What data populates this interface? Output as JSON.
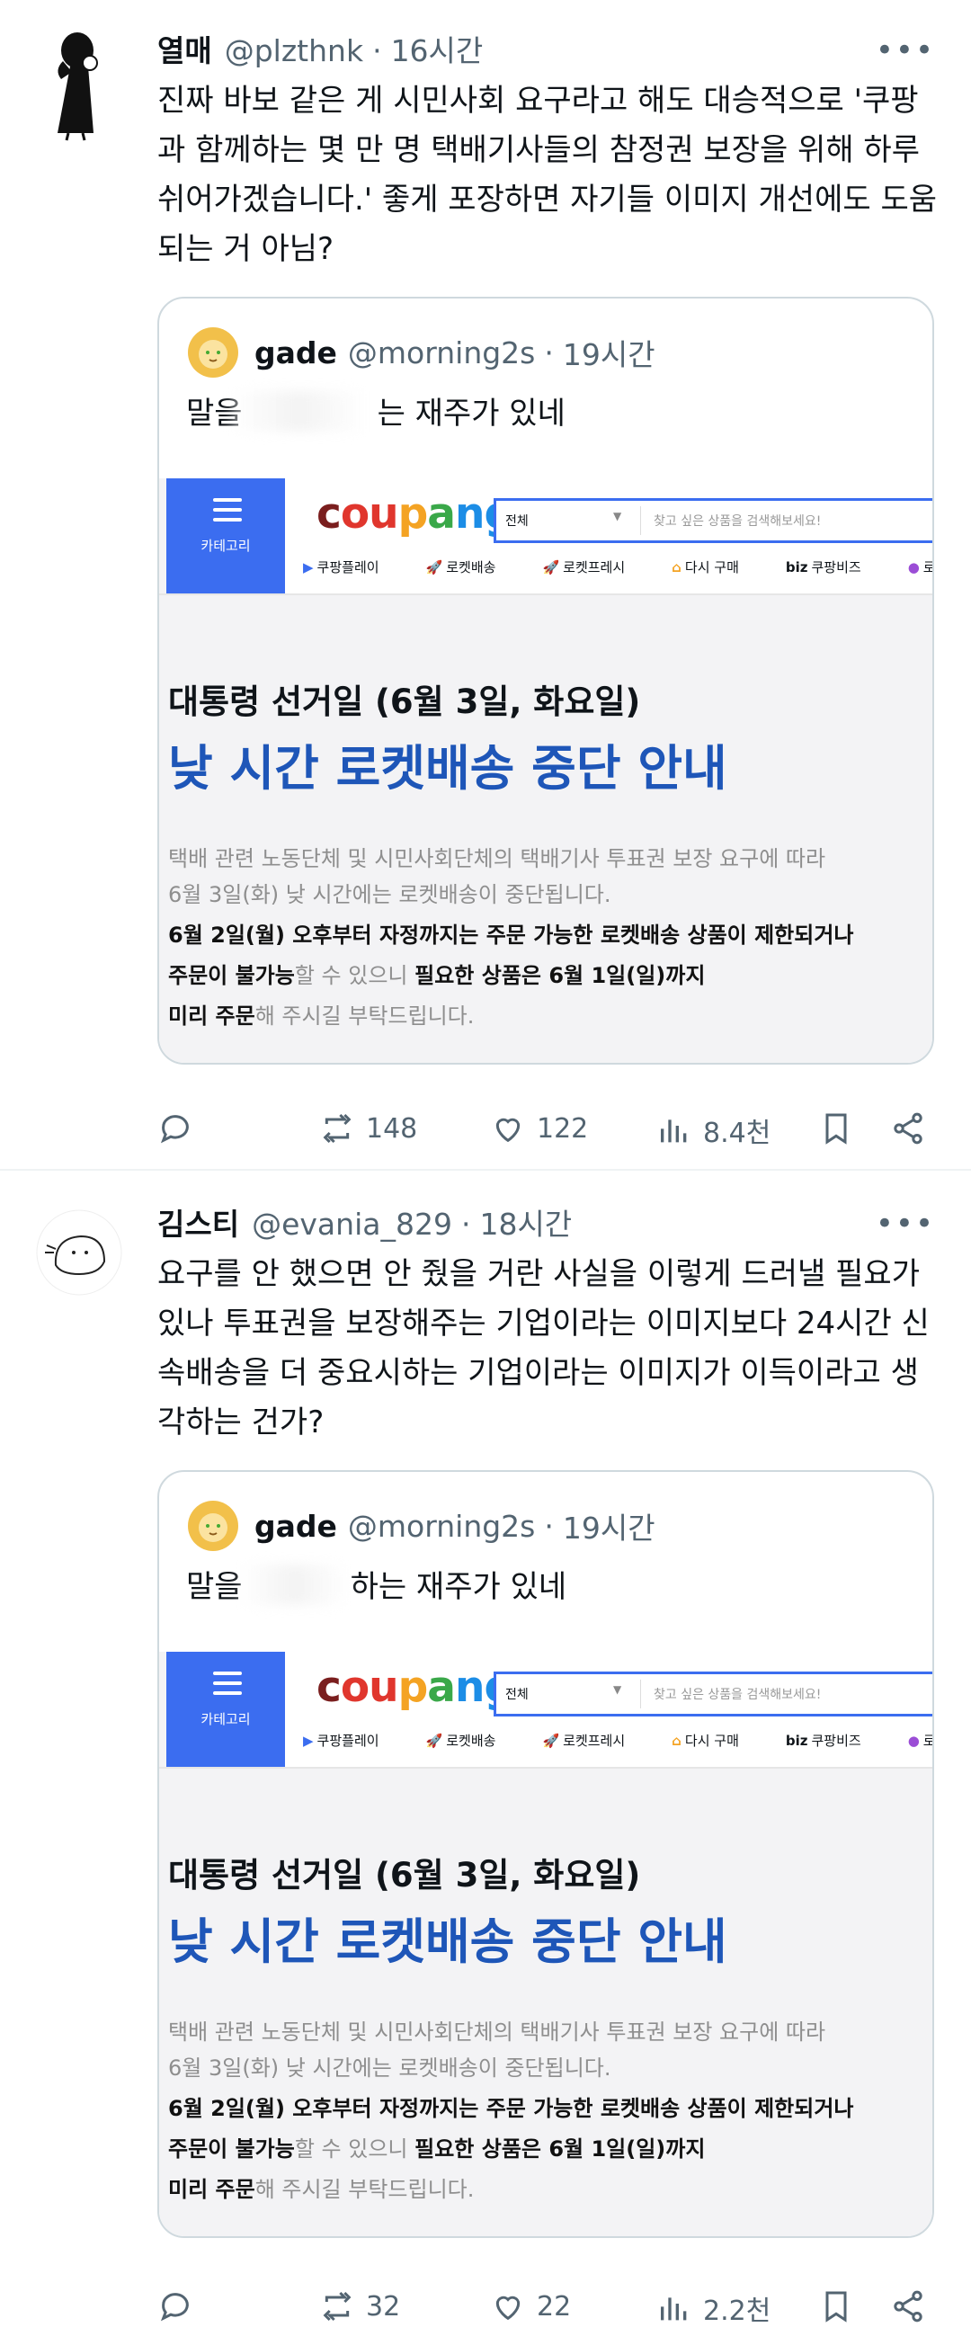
{
  "tweets": [
    {
      "name": "열매",
      "handle": "@plzthnk",
      "time": "16시간",
      "text": "진짜 바보 같은 게 시민사회 요구라고 해도 대승적으로 '쿠팡과 함께하는 몇 만 명 택배기사들의 참정권 보장을 위해 하루 쉬어가겠습니다.' 좋게 포장하면 자기들 이미지 개선에도 도움되는 거 아님?",
      "quote": {
        "name": "gade",
        "handle": "@morning2s",
        "time": "19시간",
        "text_before": "말을",
        "text_after": "는 재주가 있네"
      },
      "stats": {
        "retweets": "148",
        "likes": "122",
        "views": "8.4천"
      }
    },
    {
      "name": "김스티",
      "handle": "@evania_829",
      "time": "18시간",
      "text": "요구를 안 했으면 안 줬을 거란 사실을 이렇게 드러낼 필요가 있나 투표권을 보장해주는 기업이라는 이미지보다 24시간 신속배송을 더 중요시하는 기업이라는 이미지가 이득이라고 생각하는 건가?",
      "quote": {
        "name": "gade",
        "handle": "@morning2s",
        "time": "19시간",
        "text_before": "말을",
        "text_after": "하는 재주가 있네"
      },
      "stats": {
        "retweets": "32",
        "likes": "22",
        "views": "2.2천"
      }
    }
  ],
  "notice": {
    "category_label": "카테고리",
    "logo": [
      "c",
      "ou",
      "p",
      "a",
      "ng"
    ],
    "search_select": "전체",
    "search_placeholder": "찾고 싶은 상품을 검색해보세요!",
    "nav": [
      "쿠팡플레이",
      "로켓배송",
      "로켓프레시",
      "다시 구매",
      "쿠팡비즈",
      "로켓직구"
    ],
    "nav_biz_prefix": "biz",
    "title_small": "대통령 선거일 (6월 3일, 화요일)",
    "title_big": "낮 시간 로켓배송 중단 안내",
    "line1": "택배 관련 노동단체 및 시민사회단체의 택배기사 투표권 보장 요구에 따라",
    "line2": "6월 3일(화) 낮 시간에는 로켓배송이 중단됩니다.",
    "line3": "6월 2일(월) 오후부터 자정까지는 주문 가능한 로켓배송 상품이 제한되거나",
    "line4a": "주문이 불가능",
    "line4b": "할 수 있으니 ",
    "line4c": "필요한 상품은 6월 1일(일)까지",
    "line5a": "미리 주문",
    "line5b": "해 주시길 부탁드립니다."
  },
  "icons": {
    "more": "more-icon",
    "reply": "reply-icon",
    "retweet": "retweet-icon",
    "like": "heart-icon",
    "views": "views-icon",
    "bookmark": "bookmark-icon",
    "share": "share-icon"
  },
  "colors": {
    "accent": "#1d9bf0",
    "coupang_blue": "#3b6df0",
    "headline_blue": "#1e56b8",
    "muted": "#536471"
  }
}
